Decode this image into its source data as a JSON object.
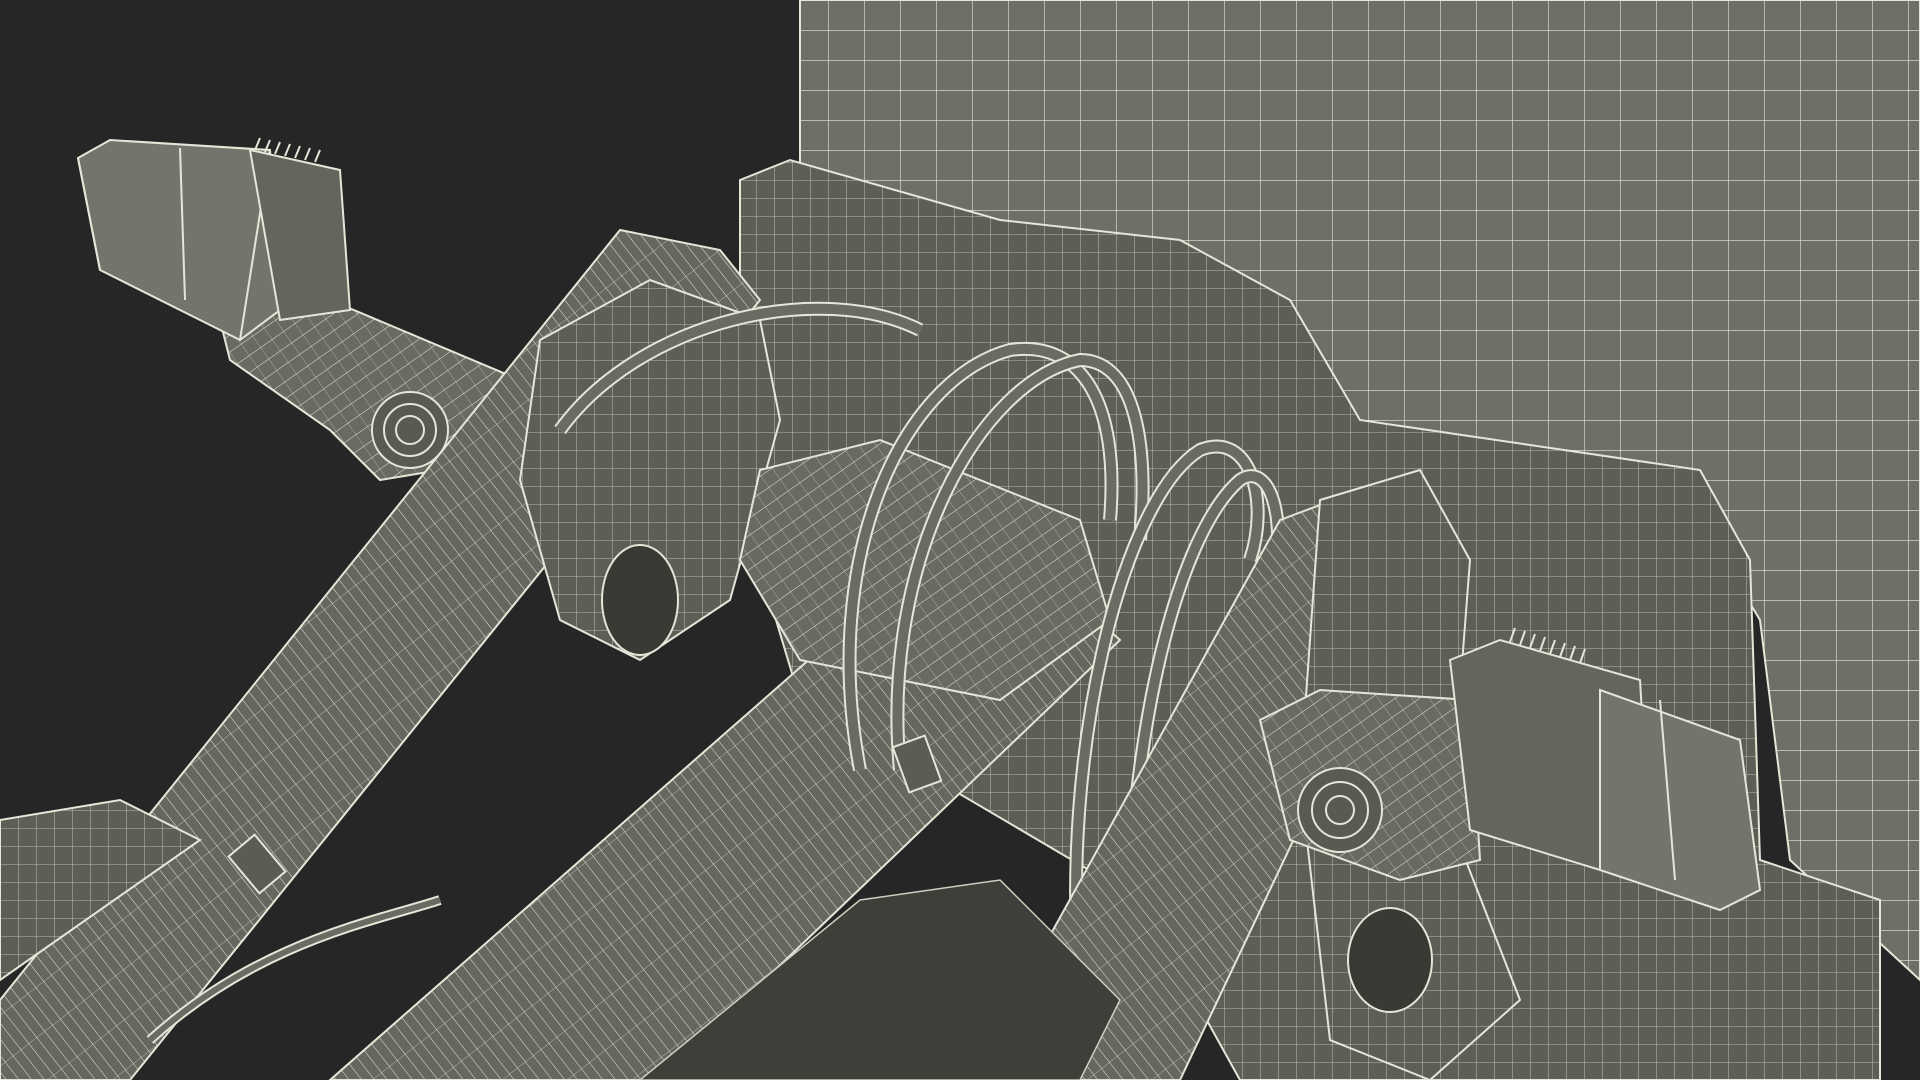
{
  "scene": {
    "subject": "wireframe-3d-render",
    "colors": {
      "background": "#262626",
      "surface": "#6e6e66",
      "surface_light": "#7d7d74",
      "surface_dark": "#55554f",
      "wire": "#e6e6d8"
    }
  }
}
